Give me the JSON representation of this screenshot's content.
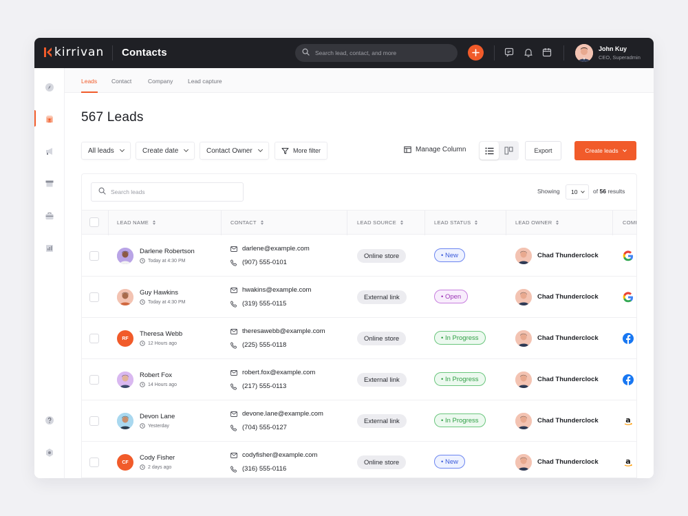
{
  "app": {
    "logo_text": "kirrivan",
    "title": "Contacts",
    "search_placeholder": "Search lead, contact, and more",
    "user": {
      "name": "John Kuy",
      "role": "CEO, Superadmin"
    }
  },
  "colors": {
    "accent": "#f15b2a",
    "topbar": "#1f2025"
  },
  "sidebar": {
    "items": [
      {
        "icon": "compass-icon"
      },
      {
        "icon": "contacts-icon",
        "active": true
      },
      {
        "icon": "megaphone-icon"
      },
      {
        "icon": "store-icon"
      },
      {
        "icon": "briefcase-icon"
      },
      {
        "icon": "report-icon"
      }
    ],
    "bottom": [
      {
        "icon": "help-icon"
      },
      {
        "icon": "settings-icon"
      }
    ]
  },
  "tabs": [
    {
      "label": "Leads",
      "active": true
    },
    {
      "label": "Contact"
    },
    {
      "label": "Company"
    },
    {
      "label": "Lead capture"
    }
  ],
  "page": {
    "heading": "567 Leads"
  },
  "filters": {
    "all_leads": "All leads",
    "create_date": "Create date",
    "contact_owner": "Contact Owner",
    "more_filter": "More filter",
    "manage_column": "Manage Column",
    "export": "Export",
    "create_leads": "Create leads"
  },
  "table": {
    "search_placeholder": "Search leads",
    "showing_label": "Showing",
    "page_size": "10",
    "results_prefix": "of",
    "results_count": "56",
    "results_suffix": "results",
    "headers": {
      "lead_name": "LEAD NAME",
      "contact": "CONTACT",
      "lead_source": "LEAD SOURCE",
      "lead_status": "LEAD STATUS",
      "lead_owner": "LEAD OWNER",
      "company": "COMP"
    },
    "rows": [
      {
        "name": "Darlene Robertson",
        "time": "Today at 4:30 PM",
        "avatar": "photo",
        "avatar_bg": "#b9a4e6",
        "email": "darlene@example.com",
        "phone": "(907) 555-0101",
        "source": "Online store",
        "status": "• New",
        "status_type": "new",
        "owner": "Chad Thunderclock",
        "company": "google-logo"
      },
      {
        "name": "Guy Hawkins",
        "time": "Today at 4:30 PM",
        "avatar": "photo",
        "avatar_bg": "#f3c3b2",
        "email": "hwakins@example.com",
        "phone": "(319) 555-0115",
        "source": "External link",
        "status": "• Open",
        "status_type": "open",
        "owner": "Chad Thunderclock",
        "company": "google-logo"
      },
      {
        "name": "Theresa Webb",
        "time": "12 Hours ago",
        "avatar": "RF",
        "avatar_bg": "#f15b2a",
        "email": "theresawebb@example.com",
        "phone": "(225) 555-0118",
        "source": "Online store",
        "status": "• In Progress",
        "status_type": "progress",
        "owner": "Chad Thunderclock",
        "company": "facebook-logo"
      },
      {
        "name": "Robert Fox",
        "time": "14 Hours ago",
        "avatar": "photo",
        "avatar_bg": "#d9b8f0",
        "email": "robert.fox@example.com",
        "phone": "(217) 555-0113",
        "source": "External link",
        "status": "• In Progress",
        "status_type": "progress",
        "owner": "Chad Thunderclock",
        "company": "facebook-logo"
      },
      {
        "name": "Devon Lane",
        "time": "Yesterday",
        "avatar": "photo",
        "avatar_bg": "#a9d8ef",
        "email": "devone.lane@example.com",
        "phone": "(704) 555-0127",
        "source": "External link",
        "status": "• In Progress",
        "status_type": "progress",
        "owner": "Chad Thunderclock",
        "company": "amazon-logo"
      },
      {
        "name": "Cody Fisher",
        "time": "2 days ago",
        "avatar": "CF",
        "avatar_bg": "#f15b2a",
        "email": "codyfisher@example.com",
        "phone": "(316) 555-0116",
        "source": "Online store",
        "status": "• New",
        "status_type": "new",
        "owner": "Chad Thunderclock",
        "company": "amazon-logo"
      }
    ]
  }
}
